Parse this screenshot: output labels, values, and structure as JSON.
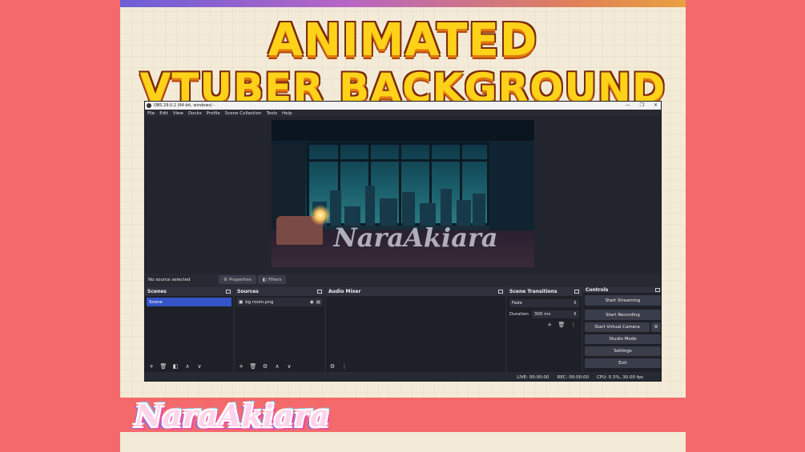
{
  "poster": {
    "title_line1": "ANIMATED",
    "title_line2": "VTUBER BACKGROUND",
    "logo_text": "NaraAkiara",
    "colors": {
      "background": "#f46a6b",
      "poster": "#f3ebd7",
      "title_fill": "#ffd21a",
      "title_outline": "#7a2a0a"
    }
  },
  "obs": {
    "window_title": "OBS 29.0.2 (64-bit, windows) -",
    "window_controls": [
      "—",
      "❐",
      "✕"
    ],
    "menu": [
      "File",
      "Edit",
      "View",
      "Docks",
      "Profile",
      "Scene Collection",
      "Tools",
      "Help"
    ],
    "canvas_watermark": "NaraAkiara",
    "status_line": {
      "no_source": "No source selected",
      "properties_label": "Properties",
      "filters_label": "Filters"
    },
    "scenes": {
      "title": "Scenes",
      "items": [
        "Scene"
      ],
      "toolbar": [
        "+",
        "🗑",
        "◧",
        "∧",
        "∨"
      ]
    },
    "sources": {
      "title": "Sources",
      "items": [
        {
          "name": "bg room.png"
        }
      ],
      "toolbar": [
        "+",
        "🗑",
        "⚙",
        "∧",
        "∨"
      ]
    },
    "audio_mixer": {
      "title": "Audio Mixer",
      "toolbar": [
        "⚙",
        "⋮"
      ]
    },
    "transitions": {
      "title": "Scene Transitions",
      "selected": "Fade",
      "duration_label": "Duration",
      "duration_value": "300 ms",
      "toolbar": [
        "+",
        "🗑",
        "⋮"
      ]
    },
    "controls": {
      "title": "Controls",
      "start_streaming": "Start Streaming",
      "start_recording": "Start Recording",
      "start_virtual_camera": "Start Virtual Camera",
      "studio_mode": "Studio Mode",
      "settings": "Settings",
      "exit": "Exit"
    },
    "statusbar": {
      "live": "LIVE: 00:00:00",
      "rec": "REC: 00:00:00",
      "cpu": "CPU: 0.3%, 30.00 fps"
    }
  }
}
